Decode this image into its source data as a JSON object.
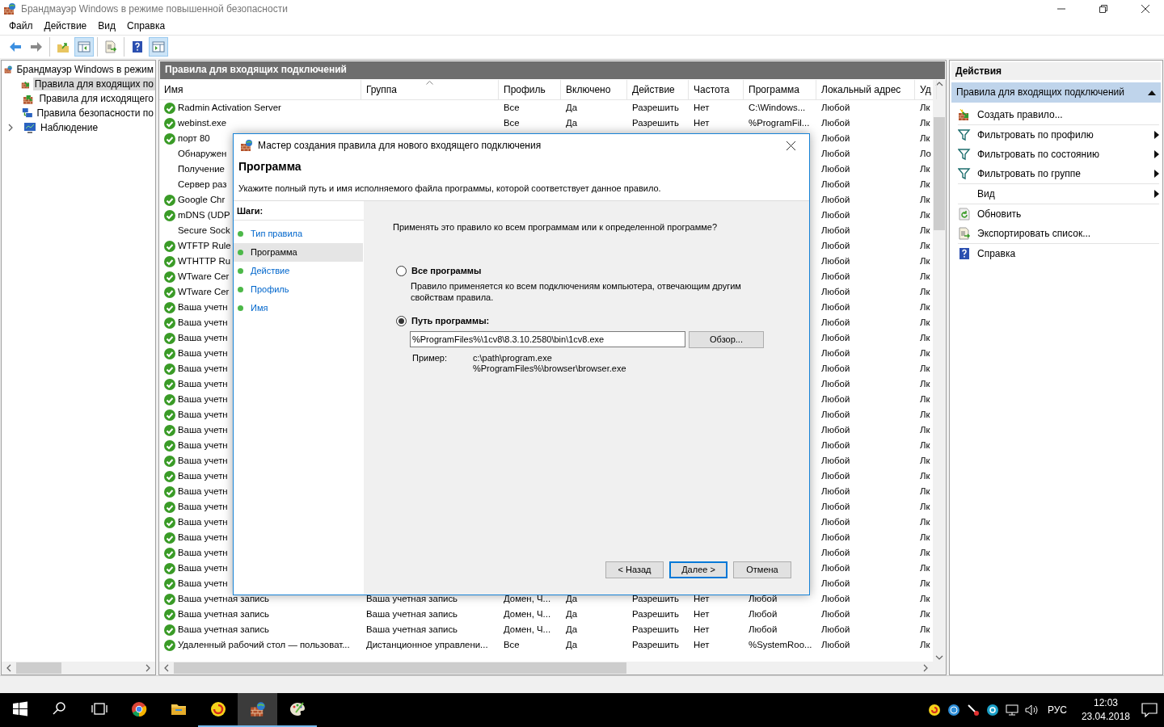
{
  "window": {
    "title": "Брандмауэр Windows в режиме повышенной безопасности"
  },
  "menu": [
    "Файл",
    "Действие",
    "Вид",
    "Справка"
  ],
  "toolbar": [
    [
      {
        "kind": "back",
        "pressed": false
      },
      {
        "kind": "forward",
        "pressed": false
      }
    ],
    [
      {
        "kind": "up",
        "pressed": false
      },
      {
        "kind": "tree",
        "pressed": true
      }
    ],
    [
      {
        "kind": "export",
        "pressed": false
      }
    ],
    [
      {
        "kind": "help",
        "pressed": false
      },
      {
        "kind": "actionpane",
        "pressed": true
      }
    ]
  ],
  "tree": {
    "label": "Брандмауэр Windows в режим",
    "selected": false,
    "children": [
      {
        "label": "Правила для входящих по",
        "kind": "inbound",
        "selected": true,
        "collapsed": false
      },
      {
        "label": "Правила для исходящего",
        "kind": "outbound",
        "selected": false,
        "collapsed": false
      },
      {
        "label": "Правила безопасности по",
        "kind": "security",
        "selected": false,
        "collapsed": false
      },
      {
        "label": "Наблюдение",
        "kind": "monitor",
        "selected": false,
        "collapsed": true
      }
    ]
  },
  "rules_panel": {
    "title": "Правила для входящих подключений",
    "columns": [
      {
        "label": "Имя",
        "sorted": false
      },
      {
        "label": "Группа",
        "sorted": true
      },
      {
        "label": "Профиль",
        "sorted": false
      },
      {
        "label": "Включено",
        "sorted": false
      },
      {
        "label": "Действие",
        "sorted": false
      },
      {
        "label": "Частота",
        "sorted": false
      },
      {
        "label": "Программа",
        "sorted": false
      },
      {
        "label": "Локальный адрес",
        "sorted": false
      },
      {
        "label": "Уд",
        "sorted": false
      }
    ],
    "rows": [
      {
        "enabled": true,
        "name": "Radmin Activation Server",
        "profile": "Все",
        "enabled_text": "Да",
        "action": "Разрешить",
        "override": "Нет",
        "program": "C:\\Windows...",
        "local": "Любой",
        "remote": "Лк"
      },
      {
        "enabled": true,
        "name": "webinst.exe",
        "profile": "Все",
        "enabled_text": "Да",
        "action": "Разрешить",
        "override": "Нет",
        "program": "%ProgramFil...",
        "local": "Любой",
        "remote": "Лк"
      },
      {
        "enabled": true,
        "name": "порт 80",
        "local": "Любой",
        "remote": "Лк"
      },
      {
        "enabled": false,
        "name": "Обнаружен",
        "local": "Любой",
        "remote": "Ло"
      },
      {
        "enabled": false,
        "name": "Получение",
        "local": "Любой",
        "remote": "Лк"
      },
      {
        "enabled": false,
        "name": "Сервер раз",
        "local": "Любой",
        "remote": "Лк"
      },
      {
        "enabled": true,
        "name": "Google Chr",
        "local": "Любой",
        "remote": "Лк"
      },
      {
        "enabled": true,
        "name": "mDNS (UDP",
        "local": "Любой",
        "remote": "Лк"
      },
      {
        "enabled": false,
        "name": "Secure Sock",
        "local": "Любой",
        "remote": "Лк"
      },
      {
        "enabled": true,
        "name": "WTFTP Rule",
        "local": "Любой",
        "remote": "Лк"
      },
      {
        "enabled": true,
        "name": "WTHTTP Ru",
        "local": "Любой",
        "remote": "Лк"
      },
      {
        "enabled": true,
        "name": "WTware Cer",
        "local": "Любой",
        "remote": "Лк"
      },
      {
        "enabled": true,
        "name": "WTware Cer",
        "local": "Любой",
        "remote": "Лк"
      },
      {
        "enabled": true,
        "name": "Ваша учетн",
        "local": "Любой",
        "remote": "Лк"
      },
      {
        "enabled": true,
        "name": "Ваша учетн",
        "local": "Любой",
        "remote": "Лк"
      },
      {
        "enabled": true,
        "name": "Ваша учетн",
        "local": "Любой",
        "remote": "Лк"
      },
      {
        "enabled": true,
        "name": "Ваша учетн",
        "local": "Любой",
        "remote": "Лк"
      },
      {
        "enabled": true,
        "name": "Ваша учетн",
        "local": "Любой",
        "remote": "Лк"
      },
      {
        "enabled": true,
        "name": "Ваша учетн",
        "local": "Любой",
        "remote": "Лк"
      },
      {
        "enabled": true,
        "name": "Ваша учетн",
        "local": "Любой",
        "remote": "Лк"
      },
      {
        "enabled": true,
        "name": "Ваша учетн",
        "local": "Любой",
        "remote": "Лк"
      },
      {
        "enabled": true,
        "name": "Ваша учетн",
        "local": "Любой",
        "remote": "Лк"
      },
      {
        "enabled": true,
        "name": "Ваша учетн",
        "local": "Любой",
        "remote": "Лк"
      },
      {
        "enabled": true,
        "name": "Ваша учетн",
        "local": "Любой",
        "remote": "Лк"
      },
      {
        "enabled": true,
        "name": "Ваша учетн",
        "local": "Любой",
        "remote": "Лк"
      },
      {
        "enabled": true,
        "name": "Ваша учетн",
        "local": "Любой",
        "remote": "Лк"
      },
      {
        "enabled": true,
        "name": "Ваша учетн",
        "local": "Любой",
        "remote": "Лк"
      },
      {
        "enabled": true,
        "name": "Ваша учетн",
        "local": "Любой",
        "remote": "Лк"
      },
      {
        "enabled": true,
        "name": "Ваша учетн",
        "local": "Любой",
        "remote": "Лк"
      },
      {
        "enabled": true,
        "name": "Ваша учетн",
        "local": "Любой",
        "remote": "Лк"
      },
      {
        "enabled": true,
        "name": "Ваша учетн",
        "local": "Любой",
        "remote": "Лк"
      },
      {
        "enabled": true,
        "name": "Ваша учетн",
        "local": "Любой",
        "remote": "Лк"
      },
      {
        "enabled": true,
        "name": "Ваша учетная запись",
        "group": "Ваша учетная запись",
        "profile": "Домен, Ч...",
        "enabled_text": "Да",
        "action": "Разрешить",
        "override": "Нет",
        "program": "Любой",
        "local": "Любой",
        "remote": "Лк"
      },
      {
        "enabled": true,
        "name": "Ваша учетная запись",
        "group": "Ваша учетная запись",
        "profile": "Домен, Ч...",
        "enabled_text": "Да",
        "action": "Разрешить",
        "override": "Нет",
        "program": "Любой",
        "local": "Любой",
        "remote": "Лк"
      },
      {
        "enabled": true,
        "name": "Ваша учетная запись",
        "group": "Ваша учетная запись",
        "profile": "Домен, Ч...",
        "enabled_text": "Да",
        "action": "Разрешить",
        "override": "Нет",
        "program": "Любой",
        "local": "Любой",
        "remote": "Лк"
      },
      {
        "enabled": true,
        "name": "Удаленный рабочий стол — пользоват...",
        "group": "Дистанционное управлени...",
        "profile": "Все",
        "enabled_text": "Да",
        "action": "Разрешить",
        "override": "Нет",
        "program": "%SystemRoo...",
        "local": "Любой",
        "remote": "Лк"
      }
    ]
  },
  "wizard": {
    "title": "Мастер создания правила для нового входящего подключения",
    "heading": "Программа",
    "description": "Укажите полный путь и имя исполняемого файла программы, которой соответствует данное правило.",
    "steps_label": "Шаги:",
    "steps": [
      {
        "label": "Тип правила",
        "selected": false
      },
      {
        "label": "Программа",
        "selected": true
      },
      {
        "label": "Действие",
        "selected": false
      },
      {
        "label": "Профиль",
        "selected": false
      },
      {
        "label": "Имя",
        "selected": false
      }
    ],
    "question": "Применять это правило ко всем программам или к определенной программе?",
    "options": [
      {
        "label": "Все программы",
        "selected": false,
        "note": "Правило применяется ко всем подключениям компьютера, отвечающим другим свойствам правила."
      },
      {
        "label": "Путь программы:",
        "selected": true
      }
    ],
    "path": {
      "value": "%ProgramFiles%\\1cv8\\8.3.10.2580\\bin\\1cv8.exe"
    },
    "browse": "Обзор...",
    "example_label": "Пример:",
    "examples": [
      "c:\\path\\program.exe",
      "%ProgramFiles%\\browser\\browser.exe"
    ],
    "buttons": [
      {
        "label": "< Назад",
        "default": false
      },
      {
        "label": "Далее >",
        "default": true
      },
      {
        "label": "Отмена",
        "default": false
      }
    ]
  },
  "actions": {
    "title": "Действия",
    "section": "Правила для входящих подключений",
    "groups": [
      [
        {
          "label": "Создать правило...",
          "kind": "new",
          "submenu": false
        }
      ],
      [
        {
          "label": "Фильтровать по профилю",
          "kind": "filter",
          "submenu": true
        },
        {
          "label": "Фильтровать по состоянию",
          "kind": "filter",
          "submenu": true
        },
        {
          "label": "Фильтровать по группе",
          "kind": "filter",
          "submenu": true
        }
      ],
      [
        {
          "label": "Вид",
          "kind": "none",
          "submenu": true
        }
      ],
      [
        {
          "label": "Обновить",
          "kind": "refresh",
          "submenu": false
        },
        {
          "label": "Экспортировать список...",
          "kind": "export",
          "submenu": false
        }
      ],
      [
        {
          "label": "Справка",
          "kind": "help",
          "submenu": false
        }
      ]
    ]
  },
  "taskbar": {
    "apps": [
      {
        "kind": "start",
        "running": false,
        "active": false
      },
      {
        "kind": "search",
        "running": false,
        "active": false
      },
      {
        "kind": "taskview",
        "running": false,
        "active": false
      },
      {
        "kind": "chrome",
        "running": false,
        "active": false
      },
      {
        "kind": "explorer",
        "running": false,
        "active": false
      },
      {
        "kind": "onec",
        "running": true,
        "active": false
      },
      {
        "kind": "firewall",
        "running": true,
        "active": true
      },
      {
        "kind": "paint",
        "running": true,
        "active": false
      }
    ],
    "language": "РУС",
    "time": "12:03",
    "date": "23.04.2018"
  }
}
